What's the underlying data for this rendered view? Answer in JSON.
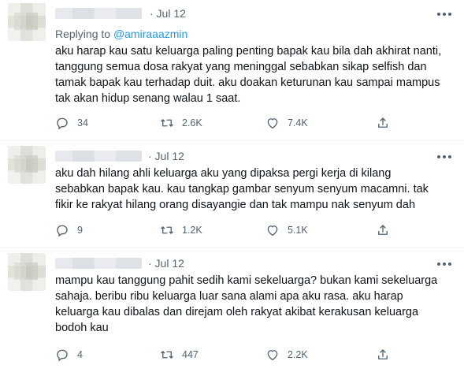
{
  "tweets": [
    {
      "date": "· Jul 12",
      "replying_prefix": "Replying to ",
      "replying_handle": "@amiraaazmin",
      "lines": [
        "aku harap kau satu keluarga paling penting bapak kau bila dah akhirat nanti,",
        "tanggung semua dosa rakyat yang meninggal sebabkan sikap selfish dan",
        "tamak bapak kau terhadap duit. aku doakan keturunan kau sampai mampus",
        "tak akan hidup senang walau 1 saat."
      ],
      "replies": "34",
      "retweets": "2.6K",
      "likes": "7.4K"
    },
    {
      "date": "· Jul 12",
      "lines": [
        "aku dah hilang ahli keluarga aku yang dipaksa pergi kerja di kilang",
        "sebabkan bapak kau. kau tangkap gambar senyum senyum macamni. tak",
        "fikir ke rakyat hilang orang disayangie dan tak mampu nak senyum dah"
      ],
      "replies": "9",
      "retweets": "1.2K",
      "likes": "5.1K"
    },
    {
      "date": "· Jul 12",
      "lines": [
        "mampu kau tanggung pahit sedih kami sekeluarga? bukan kami sekeluarga",
        "sahaja. beribu ribu keluarga luar sana alami apa aku rasa. aku harap",
        "keluarga kau dibalas dan direjam oleh rakyat akibat kerakusan keluarga",
        "bodoh kau"
      ],
      "replies": "4",
      "retweets": "447",
      "likes": "2.2K"
    }
  ]
}
